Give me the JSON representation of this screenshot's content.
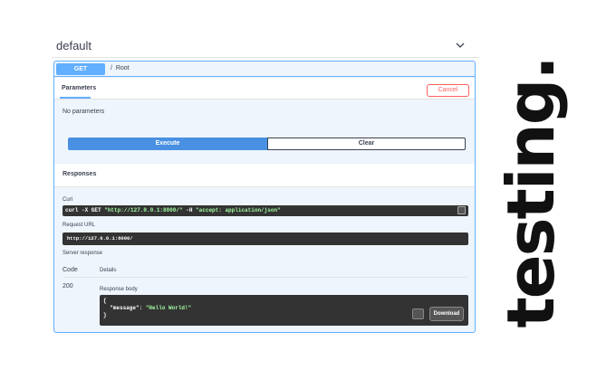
{
  "section": {
    "title": "default"
  },
  "operation": {
    "method": "GET",
    "path": "/",
    "summary": "Root"
  },
  "parameters": {
    "tab_label": "Parameters",
    "cancel_label": "Cancel",
    "empty_text": "No parameters"
  },
  "actions": {
    "execute_label": "Execute",
    "clear_label": "Clear"
  },
  "responses": {
    "title": "Responses",
    "curl_label": "Curl",
    "curl_cmd_start": "curl -X GET ",
    "curl_url": "\"http://127.0.0.1:8000/\"",
    "curl_flag": " -H  ",
    "curl_header": "\"accept: application/json\"",
    "request_url_label": "Request URL",
    "request_url": "http://127.0.0.1:8000/",
    "server_response_label": "Server response",
    "code_header": "Code",
    "details_header": "Details",
    "code": "200",
    "body_label": "Response body",
    "body_open": "{",
    "body_key": "  \"message\": ",
    "body_value": "\"Hello World!\"",
    "body_close": "}",
    "download_label": "Download"
  },
  "brand": {
    "wordmark": "testing."
  },
  "colors": {
    "accent": "#61affe",
    "execute": "#4990e2",
    "cancel": "#ff6060",
    "code_bg": "#333333",
    "string": "#a2fca2"
  },
  "icons": [
    "chevron-down-icon",
    "copy-icon"
  ]
}
